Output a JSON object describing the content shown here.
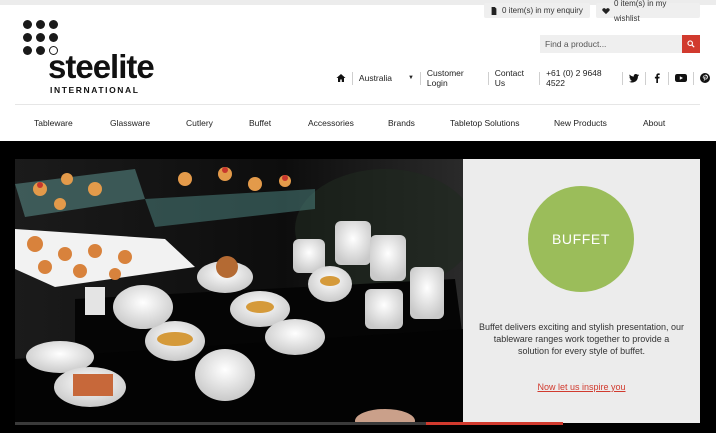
{
  "header": {
    "enquiry": "0 item(s) in my enquiry",
    "wishlist": "0 item(s) in my wishlist",
    "logo_word": "steelite",
    "logo_sub": "INTERNATIONAL",
    "search_placeholder": "Find a product...",
    "util": {
      "region": "Australia",
      "customer_login": "Customer Login",
      "contact": "Contact Us",
      "phone": "+61 (0) 2 9648 4522"
    },
    "social_icons": [
      "twitter-icon",
      "facebook-icon",
      "youtube-icon",
      "pinterest-icon"
    ]
  },
  "nav": {
    "items": [
      {
        "label": "Tableware"
      },
      {
        "label": "Glassware"
      },
      {
        "label": "Cutlery"
      },
      {
        "label": "Buffet"
      },
      {
        "label": "Accessories"
      },
      {
        "label": "Brands"
      },
      {
        "label": "Tabletop Solutions"
      },
      {
        "label": "New Products"
      },
      {
        "label": "About"
      }
    ]
  },
  "hero": {
    "badge": "BUFFET",
    "description": "Buffet delivers exciting and stylish presentation, our tableware ranges work together to provide a solution for every style of buffet.",
    "cta": "Now let us inspire you",
    "slide_progress": 0.25
  },
  "colors": {
    "accent_red": "#d13a2e",
    "badge_green": "#9bbd5a",
    "panel_grey": "#ececec"
  }
}
